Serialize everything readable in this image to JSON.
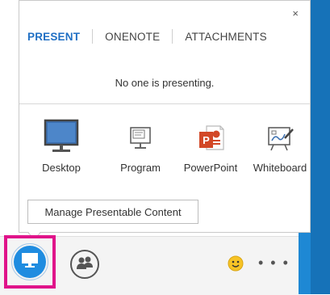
{
  "popup": {
    "close_glyph": "×",
    "tabs": [
      {
        "label": "PRESENT",
        "active": true
      },
      {
        "label": "ONENOTE",
        "active": false
      },
      {
        "label": "ATTACHMENTS",
        "active": false
      }
    ],
    "status_text": "No one is presenting.",
    "options": [
      {
        "label": "Desktop",
        "icon": "desktop-icon"
      },
      {
        "label": "Program",
        "icon": "program-icon"
      },
      {
        "label": "PowerPoint",
        "icon": "powerpoint-icon"
      },
      {
        "label": "Whiteboard",
        "icon": "whiteboard-icon"
      }
    ],
    "manage_button": "Manage Presentable Content"
  },
  "toolbar": {
    "present_icon": "present-icon",
    "people_icon": "participants-icon",
    "emoticon_icon": "smiley-icon",
    "more_glyph": "• • •"
  },
  "colors": {
    "accent": "#1f6fc4",
    "present_blue": "#1f8ce0",
    "highlight": "#e0148a",
    "side_blue": "#1e88d4"
  }
}
